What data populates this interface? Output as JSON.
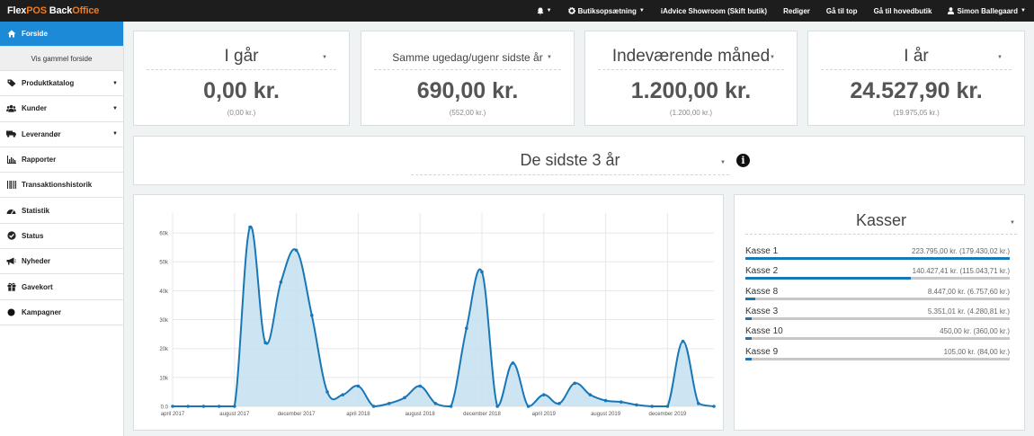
{
  "topbar": {
    "logo_part1": "Flex",
    "logo_part2": "POS",
    "logo_part3": " Back",
    "logo_part4": "Office",
    "bell": "▲",
    "setup_label": "Butiksopsætning",
    "store_label": "iAdvice Showroom (Skift butik)",
    "edit_label": "Rediger",
    "top_label": "Gå til top",
    "main_store_label": "Gå til hovedbutik",
    "user_label": "Simon Ballegaard"
  },
  "sidebar": {
    "items": [
      {
        "label": "Forside",
        "icon": "home-icon"
      },
      {
        "label": "Vis gammel forside"
      },
      {
        "label": "Produktkatalog",
        "icon": "tag-icon",
        "expand": true
      },
      {
        "label": "Kunder",
        "icon": "users-icon",
        "expand": true
      },
      {
        "label": "Leverandør",
        "icon": "truck-icon",
        "expand": true
      },
      {
        "label": "Rapporter",
        "icon": "chart-icon"
      },
      {
        "label": "Transaktionshistorik",
        "icon": "barcode-icon"
      },
      {
        "label": "Statistik",
        "icon": "dashboard-icon"
      },
      {
        "label": "Status",
        "icon": "check-circle-icon"
      },
      {
        "label": "Nyheder",
        "icon": "bullhorn-icon"
      },
      {
        "label": "Gavekort",
        "icon": "gift-icon"
      },
      {
        "label": "Kampagner",
        "icon": "circle-icon"
      }
    ]
  },
  "kpis": [
    {
      "title": "I går",
      "value": "0,00 kr.",
      "prev": "(0,00 kr.)"
    },
    {
      "title": "Samme ugedag/ugenr sidste år",
      "value": "690,00 kr.",
      "prev": "(552,00 kr.)"
    },
    {
      "title": "Indeværende måned",
      "value": "1.200,00 kr.",
      "prev": "(1.200,00 kr.)"
    },
    {
      "title": "I år",
      "value": "24.527,90 kr.",
      "prev": "(19.975,05 kr.)"
    }
  ],
  "period": {
    "label": "De sidste 3 år",
    "info": "i"
  },
  "kasser": {
    "title": "Kasser",
    "rows": [
      {
        "name": "Kasse 1",
        "value": "223.795,00 kr. (179.430,02 kr.)",
        "fraction": 1.0
      },
      {
        "name": "Kasse 2",
        "value": "140.427,41 kr. (115.043,71 kr.)",
        "fraction": 0.627
      },
      {
        "name": "Kasse 8",
        "value": "8.447,00 kr. (6.757,60 kr.)",
        "fraction": 0.038
      },
      {
        "name": "Kasse 3",
        "value": "5.351,01 kr. (4.280,81 kr.)",
        "fraction": 0.024
      },
      {
        "name": "Kasse 10",
        "value": "450,00 kr. (360,00 kr.)",
        "fraction": 0.002
      },
      {
        "name": "Kasse 9",
        "value": "105,00 kr. (84,00 kr.)",
        "fraction": 0.0005
      }
    ]
  },
  "chart_data": {
    "type": "area",
    "x": [
      "april 2017",
      "maj 2017",
      "juni 2017",
      "juli 2017",
      "august 2017",
      "september 2017",
      "oktober 2017",
      "november 2017",
      "december 2017",
      "januar 2018",
      "februar 2018",
      "marts 2018",
      "april 2018",
      "maj 2018",
      "juni 2018",
      "juli 2018",
      "august 2018",
      "september 2018",
      "oktober 2018",
      "november 2018",
      "december 2018",
      "januar 2019",
      "februar 2019",
      "marts 2019",
      "april 2019",
      "maj 2019",
      "juni 2019",
      "juli 2019",
      "august 2019",
      "september 2019",
      "oktober 2019",
      "november 2019",
      "december 2019",
      "januar 2020",
      "februar 2020",
      "marts 2020"
    ],
    "values": [
      0,
      0,
      0,
      0,
      0,
      62000,
      22000,
      43000,
      54000,
      31500,
      5000,
      4000,
      7000,
      0,
      1000,
      3000,
      7000,
      1000,
      0,
      27000,
      46500,
      0,
      15000,
      0,
      4000,
      1000,
      8000,
      4000,
      2000,
      1500,
      500,
      0,
      0,
      22500,
      1000,
      0
    ],
    "tick_labels": [
      "april 2017",
      "august 2017",
      "december 2017",
      "april 2018",
      "august 2018",
      "december 2018",
      "april 2019",
      "august 2019",
      "december 2019"
    ],
    "tick_indices": [
      0,
      4,
      8,
      12,
      16,
      20,
      24,
      28,
      32
    ],
    "y_ticks": [
      "0.0",
      "10k",
      "20k",
      "30k",
      "40k",
      "50k",
      "60k"
    ],
    "ylim": [
      0,
      65000
    ],
    "grid": true,
    "color": "#1a77b6"
  }
}
